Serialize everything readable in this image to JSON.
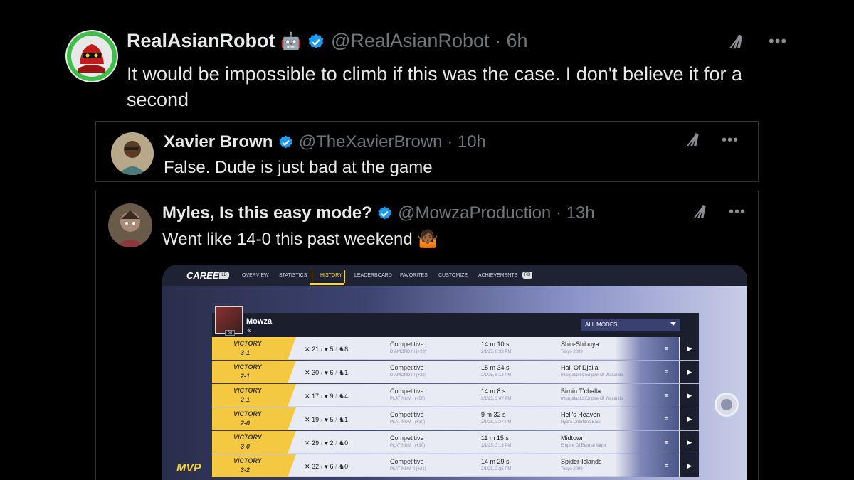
{
  "main_tweet": {
    "name": "RealAsianRobot",
    "emoji": "🤖",
    "handle": "@RealAsianRobot",
    "time": "· 6h",
    "text": "It would be impossible to climb if this was the case. I don't believe it for a second"
  },
  "quote1": {
    "name": "Xavier Brown",
    "handle": "@TheXavierBrown",
    "time": "· 10h",
    "text": "False. Dude is just bad at the game"
  },
  "quote2": {
    "name": "Myles, Is this easy mode?",
    "handle": "@MowzaProduction",
    "time": "· 13h",
    "text": "Went like 14-0 this past weekend 🤷🏾"
  },
  "icons": {
    "grok": "grok-icon",
    "more": "more-icon",
    "verified": "verified-badge-icon",
    "verified_color": "#1d9bf0"
  },
  "game": {
    "title": "CAREER",
    "lb": "LB",
    "rb": "RB",
    "tabs": [
      "OVERVIEW",
      "STATISTICS",
      "HISTORY",
      "LEADERBOARD",
      "FAVORITES",
      "CUSTOMIZE",
      "ACHIEVEMENTS"
    ],
    "active_tab": "HISTORY",
    "player_name": "Mowza",
    "player_level": "68",
    "mode_filter": "ALL MODES",
    "mvp": "MVP",
    "accent": "#f5d23a",
    "rows": [
      {
        "result": "VICTORY",
        "score": "3-1",
        "kills": "21",
        "deaths": "5",
        "assists": "8",
        "mode": "Competitive",
        "rank": "DIAMOND III (+23)",
        "duration": "14 m 10 s",
        "date": "2/1/25, 8:33 PM",
        "map": "Shin-Shibuya",
        "region": "Tokyo 2099"
      },
      {
        "result": "VICTORY",
        "score": "2-1",
        "kills": "30",
        "deaths": "6",
        "assists": "1",
        "mode": "Competitive",
        "rank": "DIAMOND III (+26)",
        "duration": "15 m 34 s",
        "date": "2/1/25, 8:12 PM",
        "map": "Hall Of Djalia",
        "region": "Intergalactic Empire Of Wakanda"
      },
      {
        "result": "VICTORY",
        "score": "2-1",
        "kills": "17",
        "deaths": "9",
        "assists": "4",
        "mode": "Competitive",
        "rank": "PLATINUM I (+30)",
        "duration": "14 m 8 s",
        "date": "2/1/25, 3:47 PM",
        "map": "Birnin T'challa",
        "region": "Intergalactic Empire Of Wakanda"
      },
      {
        "result": "VICTORY",
        "score": "2-0",
        "kills": "19",
        "deaths": "5",
        "assists": "1",
        "mode": "Competitive",
        "rank": "PLATINUM I (+30)",
        "duration": "9 m 32 s",
        "date": "2/1/25, 3:27 PM",
        "map": "Hell's Heaven",
        "region": "Hydra Charteris Base"
      },
      {
        "result": "VICTORY",
        "score": "3-0",
        "kills": "29",
        "deaths": "2",
        "assists": "0",
        "mode": "Competitive",
        "rank": "PLATINUM I (+30)",
        "duration": "11 m 15 s",
        "date": "2/1/25, 3:13 PM",
        "map": "Midtown",
        "region": "Empire Of Eternal Night"
      },
      {
        "result": "VICTORY",
        "score": "3-2",
        "kills": "32",
        "deaths": "6",
        "assists": "0",
        "mode": "Competitive",
        "rank": "PLATINUM II (+31)",
        "duration": "14 m 29 s",
        "date": "2/1/25, 2:35 PM",
        "map": "Spider-Islands",
        "region": "Tokyo 2099"
      }
    ]
  }
}
